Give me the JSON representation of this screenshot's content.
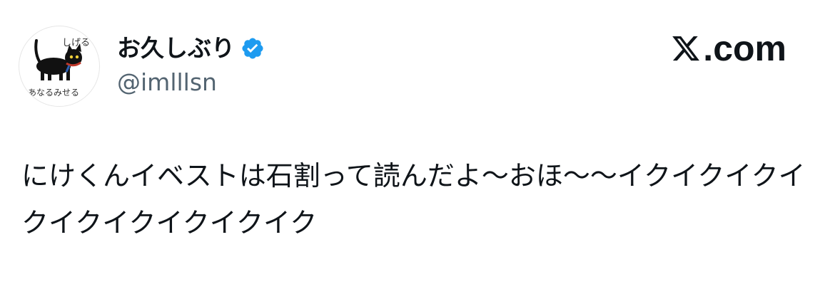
{
  "author": {
    "display_name": "お久しぶり",
    "handle": "@imlllsn",
    "verified": true,
    "avatar": {
      "text_top": "しげる",
      "text_bottom": "あなるみせる"
    }
  },
  "brand": {
    "label": ".com",
    "icon": "x-logo-icon"
  },
  "tweet": {
    "text": "にけくんイベストは石割って読んだよ〜おほ〜〜イクイクイクイクイクイクイクイクイク"
  },
  "colors": {
    "text_primary": "#0f1419",
    "text_secondary": "#536471",
    "verified_blue": "#1d9bf0",
    "background": "#ffffff"
  }
}
